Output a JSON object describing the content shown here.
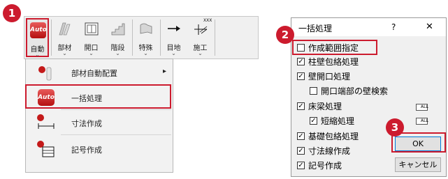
{
  "toolbar": {
    "buttons": [
      {
        "label": "自動",
        "icon": "auto-icon",
        "badge_text": "Auto"
      },
      {
        "label": "部材",
        "icon": "member-icon"
      },
      {
        "label": "開口",
        "icon": "opening-icon"
      },
      {
        "label": "階段",
        "icon": "stairs-icon"
      },
      {
        "label": "特殊",
        "icon": "special-icon"
      },
      {
        "label": "目地",
        "icon": "joint-icon"
      },
      {
        "label": "施工",
        "icon": "construction-icon",
        "badge_text": "XXX"
      }
    ],
    "chevron": "⌄"
  },
  "menu": {
    "items": [
      {
        "label": "部材自動配置",
        "icon": "member-auto-place-icon",
        "has_submenu": true
      },
      {
        "label": "一括処理",
        "icon": "auto-icon",
        "badge_text": "Auto"
      },
      {
        "label": "寸法作成",
        "icon": "dimension-icon"
      },
      {
        "label": "記号作成",
        "icon": "symbol-icon"
      }
    ],
    "submenu_arrow": "▸"
  },
  "dialog": {
    "title": "一括処理",
    "help": "?",
    "close": "✕",
    "options": [
      {
        "label": "作成範囲指定",
        "checked": false
      },
      {
        "label": "柱壁包絡処理",
        "checked": true
      },
      {
        "label": "壁開口処理",
        "checked": true
      },
      {
        "label": "開口端部の壁検索",
        "checked": false
      },
      {
        "label": "床梁処理",
        "checked": true
      },
      {
        "label": "短縮処理",
        "checked": true
      },
      {
        "label": "基礎包絡処理",
        "checked": true
      },
      {
        "label": "寸法線作成",
        "checked": true
      },
      {
        "label": "記号作成",
        "checked": true
      }
    ],
    "all_label": "ALL",
    "ok": "OK",
    "cancel": "キャンセル"
  },
  "steps": [
    "1",
    "2",
    "3"
  ],
  "colors": {
    "highlight": "#cc1b2e",
    "auto_red": "#c41a1a"
  }
}
